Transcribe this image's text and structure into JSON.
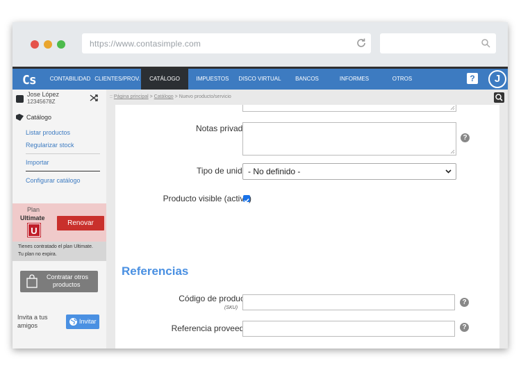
{
  "browser": {
    "url": "https://www.contasimple.com",
    "dot_colors": [
      "#e5534b",
      "#e9a52e",
      "#4cbb4c"
    ]
  },
  "nav": {
    "logo": "Cs",
    "items": [
      "CONTABILIDAD",
      "CLIENTES/PROV.",
      "CATÁLOGO",
      "IMPUESTOS",
      "DISCO VIRTUAL",
      "BANCOS",
      "INFORMES",
      "OTROS"
    ],
    "active": "CATÁLOGO",
    "help": "?",
    "avatar": "J",
    "accent": "#3d7bc1"
  },
  "user": {
    "name": "Jose López",
    "id": "12345678Z"
  },
  "breadcrumb": {
    "prefix": "::",
    "home": "Página principal",
    "section": "Catálogo",
    "current": "Nuevo producto/servicio",
    "sep": ">"
  },
  "sidebar": {
    "title": "Catálogo",
    "links": [
      "Listar productos",
      "Regularizar stock",
      "Importar",
      "Configurar catálogo"
    ],
    "plan_label": "Plan",
    "plan_name": "Ultimate",
    "plan_badge": "U",
    "renew": "Renovar",
    "plan_info_1": "Tienes contratado el plan Ultimate.",
    "plan_info_2": "Tu plan no expira.",
    "contract_1": "Contratar otros",
    "contract_2": "productos",
    "invite_1": "Invita a tus",
    "invite_2": "amigos",
    "invite_button": "Invitar"
  },
  "form": {
    "notes_label": "Notas privadas",
    "unit_label": "Tipo de unidad",
    "unit_value": "- No definido -",
    "visible_label": "Producto visible (activo)",
    "visible_checked": true,
    "section_title": "Referencias",
    "sku_label": "Código de producto",
    "sku_sub": "(SKU)",
    "supplier_label": "Referencia proveedor",
    "help": "?"
  }
}
